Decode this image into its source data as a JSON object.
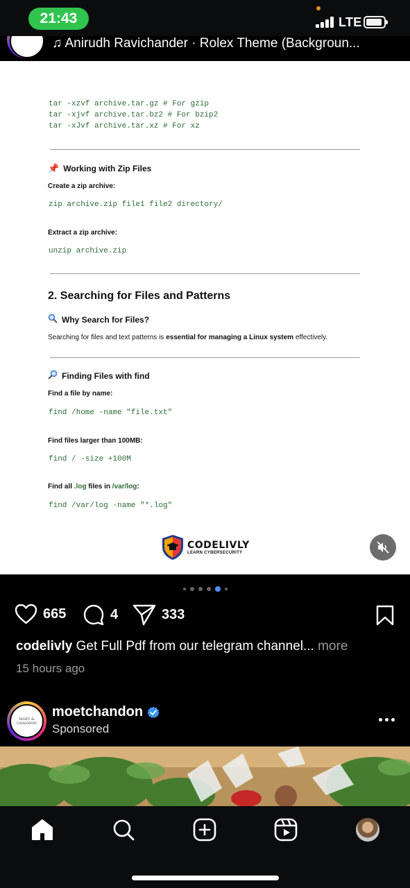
{
  "status_bar": {
    "time": "21:43",
    "network": "LTE"
  },
  "post_header": {
    "music": "♫ Anirudh Ravichander · Rolex Theme (Backgroun..."
  },
  "document": {
    "tar_cmds": [
      "tar -xzvf archive.tar.gz # For gzip",
      "tar -xjvf archive.tar.bz2 # For bzip2",
      "tar -xJvf archive.tar.xz # For xz"
    ],
    "zip_heading": "Working with Zip Files",
    "create_label": "Create a zip archive:",
    "zip_cmd": "zip archive.zip file1 file2 directory/",
    "extract_label": "Extract a zip archive:",
    "unzip_cmd": "unzip archive.zip",
    "section_title": "2. Searching for Files and Patterns",
    "why_heading": "Why Search for Files?",
    "why_text_a": "Searching for files and text patterns is ",
    "why_text_b": "essential for managing a Linux system",
    "why_text_c": " effectively.",
    "find_heading": "Finding Files with find",
    "by_name_label": "Find a file by name:",
    "by_name_cmd": "find /home -name \"file.txt\"",
    "larger_label": "Find files larger than 100MB:",
    "larger_cmd": "find / -size +100M",
    "log_label_a": "Find all ",
    "log_label_b": ".log",
    "log_label_c": " files in ",
    "log_label_d": "/var/log",
    "log_label_e": ":",
    "log_cmd": "find /var/log -name \"*.log\"",
    "logo_main": "CODELIVLY",
    "logo_sub": "LEARN CYBERSECURITY"
  },
  "carousel": {
    "count": 6,
    "active_index": 4
  },
  "actions": {
    "likes": "665",
    "comments": "4",
    "shares": "333"
  },
  "caption": {
    "user": "codelivly",
    "text": " Get Full Pdf from our telegram channel...",
    "more": " more",
    "time_ago": "15 hours ago"
  },
  "sponsored": {
    "name": "moetchandon",
    "label": "Sponsored",
    "avatar_text": "MOËT & CHANDON"
  },
  "colors": {
    "accent_blue": "#4f8cff",
    "time_pill": "#30c44f",
    "code_green": "#2f6b3a"
  }
}
